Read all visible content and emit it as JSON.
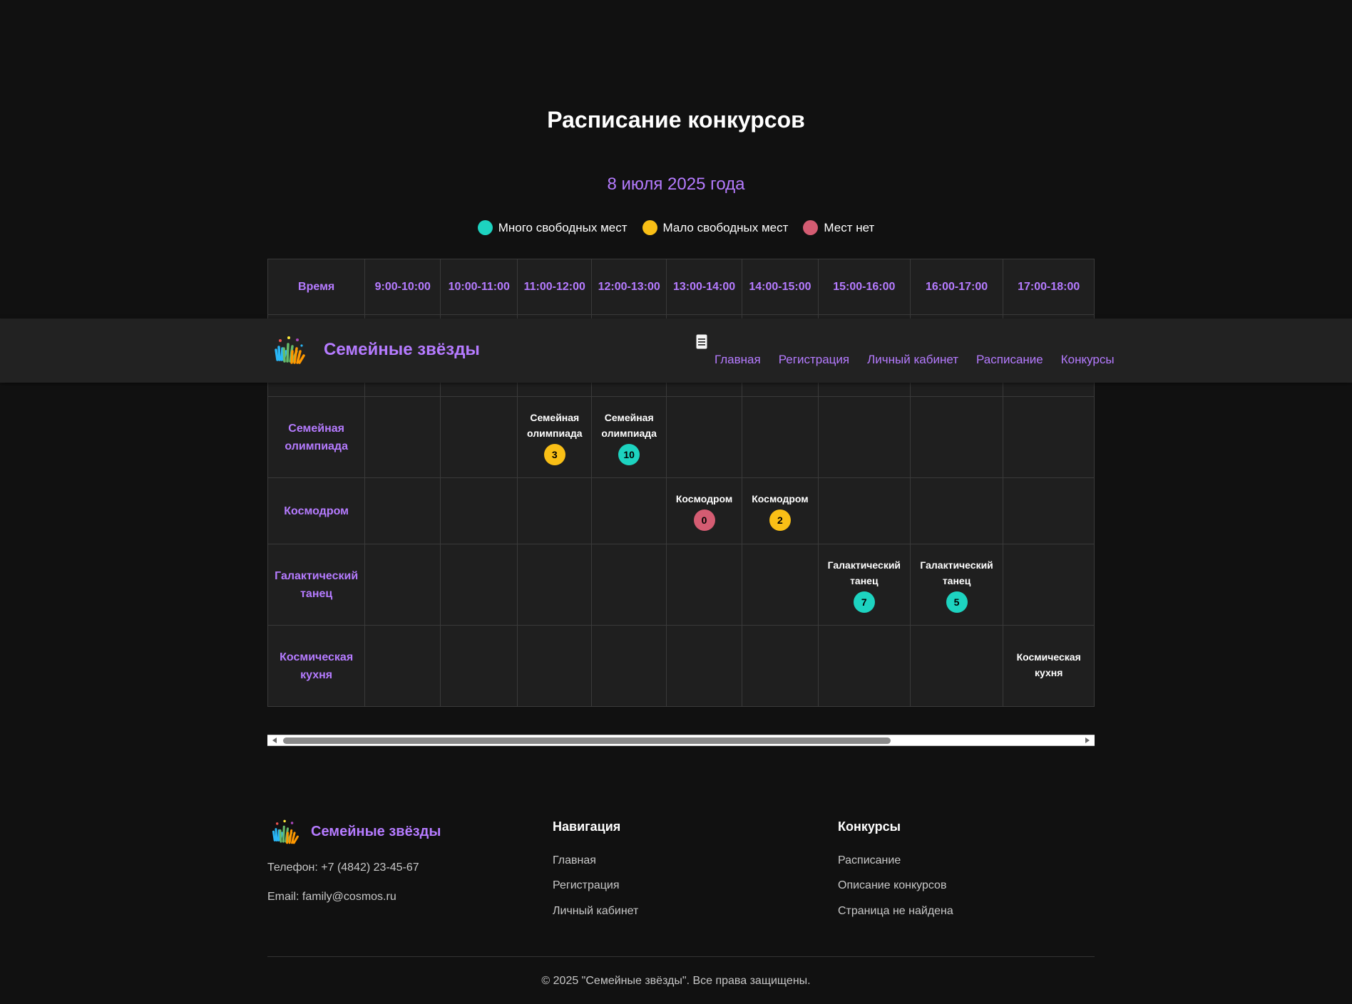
{
  "header": {
    "brand": "Семейные звёзды",
    "nav": [
      "Главная",
      "Регистрация",
      "Личный кабинет",
      "Расписание",
      "Конкурсы"
    ]
  },
  "main": {
    "title": "Расписание конкурсов",
    "date": "8 июля 2025 года",
    "legend": [
      {
        "label": "Много свободных мест",
        "color": "#1dd3c0"
      },
      {
        "label": "Мало свободных мест",
        "color": "#f9bf16"
      },
      {
        "label": "Мест нет",
        "color": "#d45c72"
      }
    ]
  },
  "schedule": {
    "time_header": "Время",
    "slots": [
      "9:00-10:00",
      "10:00-11:00",
      "11:00-12:00",
      "12:00-13:00",
      "13:00-14:00",
      "14:00-15:00",
      "15:00-16:00",
      "16:00-17:00",
      "17:00-18:00"
    ],
    "rows": [
      {
        "name": "",
        "cells": [
          null,
          null,
          null,
          null,
          null,
          null,
          null,
          null,
          null
        ]
      },
      {
        "name": "Семейная олимпиада",
        "cells": [
          null,
          null,
          {
            "event": "Семейная олимпиада",
            "seats": "3",
            "status": "few"
          },
          {
            "event": "Семейная олимпиада",
            "seats": "10",
            "status": "many"
          },
          null,
          null,
          null,
          null,
          null
        ]
      },
      {
        "name": "Космодром",
        "cells": [
          null,
          null,
          null,
          null,
          {
            "event": "Космодром",
            "seats": "0",
            "status": "none"
          },
          {
            "event": "Космодром",
            "seats": "2",
            "status": "few"
          },
          null,
          null,
          null
        ]
      },
      {
        "name": "Галактический танец",
        "cells": [
          null,
          null,
          null,
          null,
          null,
          null,
          {
            "event": "Галактический танец",
            "seats": "7",
            "status": "many"
          },
          {
            "event": "Галактический танец",
            "seats": "5",
            "status": "many"
          },
          null
        ]
      },
      {
        "name": "Космическая кухня",
        "cells": [
          null,
          null,
          null,
          null,
          null,
          null,
          null,
          null,
          {
            "event": "Космическая кухня",
            "seats": "",
            "status": "many"
          }
        ]
      }
    ]
  },
  "colors": {
    "many": "#1dd3c0",
    "few": "#f9bf16",
    "none": "#d45c72",
    "accent": "#b57bff"
  },
  "footer": {
    "brand": "Семейные звёзды",
    "phone": "Телефон: +7 (4842) 23-45-67",
    "email": "Email: family@cosmos.ru",
    "nav_heading": "Навигация",
    "nav_links": [
      "Главная",
      "Регистрация",
      "Личный кабинет"
    ],
    "contests_heading": "Конкурсы",
    "contests_links": [
      "Расписание",
      "Описание конкурсов",
      "Страница не найдена"
    ],
    "copyright": "© 2025 \"Семейные звёзды\". Все права защищены."
  }
}
